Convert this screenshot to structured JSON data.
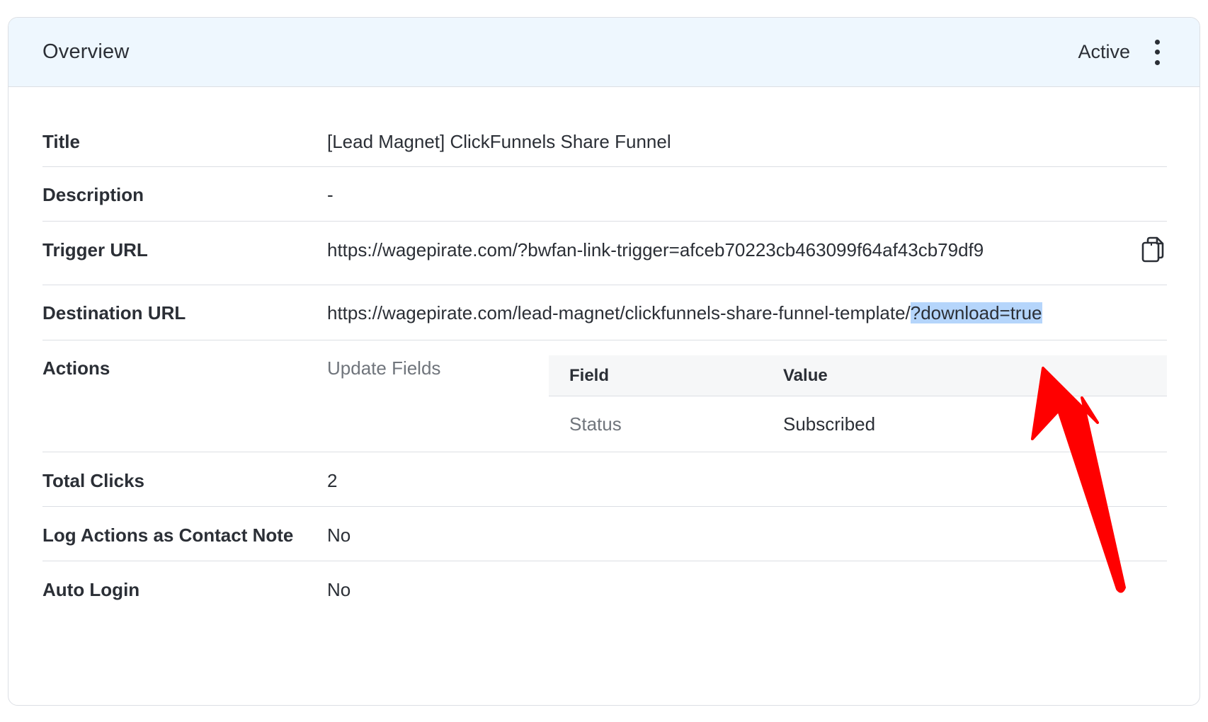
{
  "header": {
    "title": "Overview",
    "status": "Active"
  },
  "rows": {
    "title": {
      "label": "Title",
      "value": "[Lead Magnet] ClickFunnels Share Funnel"
    },
    "description": {
      "label": "Description",
      "value": "-"
    },
    "trigger_url": {
      "label": "Trigger URL",
      "value": "https://wagepirate.com/?bwfan-link-trigger=afceb70223cb463099f64af43cb79df9"
    },
    "destination_url": {
      "label": "Destination URL",
      "value_main": "https://wagepirate.com/lead-magnet/clickfunnels-share-funnel-template/",
      "value_highlighted": "?download=true"
    },
    "actions": {
      "label": "Actions",
      "type": "Update Fields",
      "table": {
        "columns": [
          "Field",
          "Value"
        ],
        "rows": [
          {
            "field": "Status",
            "value": "Subscribed"
          }
        ]
      }
    },
    "total_clicks": {
      "label": "Total Clicks",
      "value": "2"
    },
    "log_actions": {
      "label": "Log Actions as Contact Note",
      "value": "No"
    },
    "auto_login": {
      "label": "Auto Login",
      "value": "No"
    }
  },
  "icons": {
    "copy": "copy-icon",
    "menu": "kebab-menu-icon",
    "annotation": "red-arrow-annotation"
  },
  "colors": {
    "header_bg": "#eef7fe",
    "border": "#dcdfe4",
    "text_highlight": "#b5d5fb",
    "arrow": "#ff0000",
    "muted_text": "#70757c"
  }
}
